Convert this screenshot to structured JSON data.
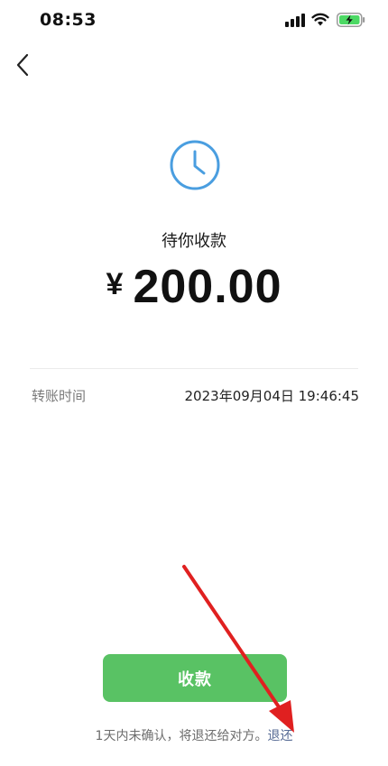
{
  "status_bar": {
    "time": "08:53",
    "icons": [
      "signal-icon",
      "wifi-icon",
      "battery-charging-icon"
    ],
    "battery_color": "#4cd964"
  },
  "nav": {
    "back_icon": "chevron-left-icon"
  },
  "transfer": {
    "status_icon": "clock-icon",
    "status_icon_color": "#4a9ee0",
    "status_text": "待你收款",
    "currency": "¥",
    "amount": "200.00",
    "detail": {
      "label": "转账时间",
      "value": "2023年09月04日 19:46:45"
    }
  },
  "actions": {
    "receive_label": "收款",
    "receive_color": "#59c264"
  },
  "footer": {
    "note": "1天内未确认，将退还给对方。",
    "return_link": "退还",
    "link_color": "#576b95"
  },
  "annotation": {
    "arrow_color": "#e02020"
  }
}
